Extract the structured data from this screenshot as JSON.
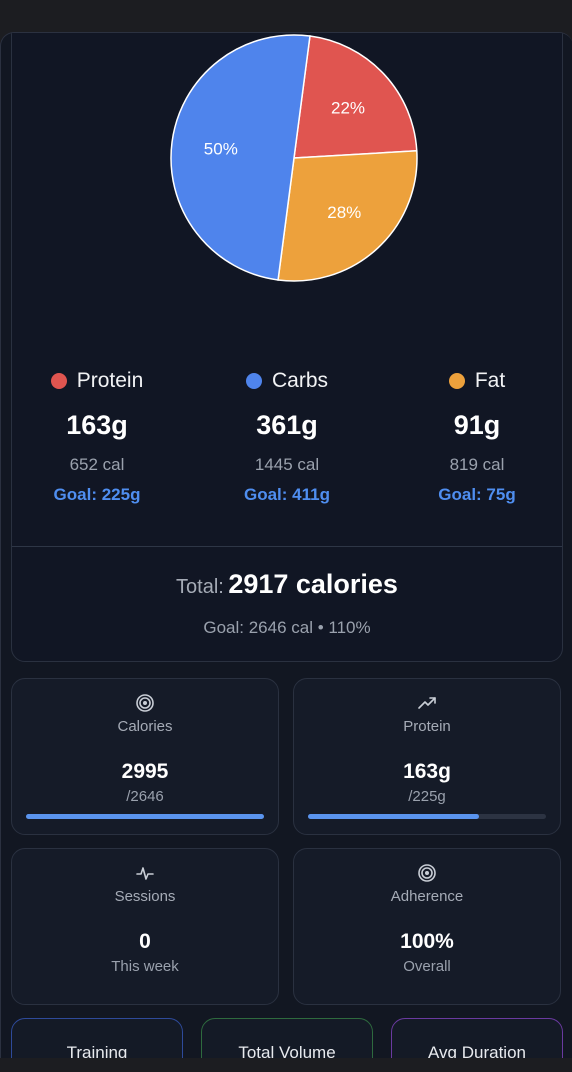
{
  "pie": {
    "slices": [
      {
        "label": "22%",
        "value": 22,
        "color": "#e05550"
      },
      {
        "label": "28%",
        "value": 28,
        "color": "#eda13c"
      },
      {
        "label": "50%",
        "value": 50,
        "color": "#4f84ec"
      }
    ]
  },
  "macros": [
    {
      "name": "Protein",
      "color": "#e05550",
      "grams": "163g",
      "calories": "652 cal",
      "goal": "Goal: 225g"
    },
    {
      "name": "Carbs",
      "color": "#4f84ec",
      "grams": "361g",
      "calories": "1445 cal",
      "goal": "Goal: 411g"
    },
    {
      "name": "Fat",
      "color": "#eda13c",
      "grams": "91g",
      "calories": "819 cal",
      "goal": "Goal: 75g"
    }
  ],
  "total": {
    "label": "Total:",
    "value": "2917 calories",
    "sub": "Goal: 2646 cal • 110%"
  },
  "stats": [
    {
      "label": "Calories",
      "icon": "target-icon",
      "value": "2995",
      "sub": "/2646",
      "progress": 1.0
    },
    {
      "label": "Protein",
      "icon": "trending-up-icon",
      "value": "163g",
      "sub": "/225g",
      "progress": 0.72
    },
    {
      "label": "Sessions",
      "icon": "activity-icon",
      "value": "0",
      "sub": "This week"
    },
    {
      "label": "Adherence",
      "icon": "target-icon",
      "value": "100%",
      "sub": "Overall"
    }
  ],
  "bottom_cards": [
    {
      "label": "Training",
      "border": "#2e4a9a"
    },
    {
      "label": "Total Volume",
      "border": "#2e6a3e"
    },
    {
      "label": "Avg Duration",
      "border": "#6a3aa0"
    }
  ]
}
